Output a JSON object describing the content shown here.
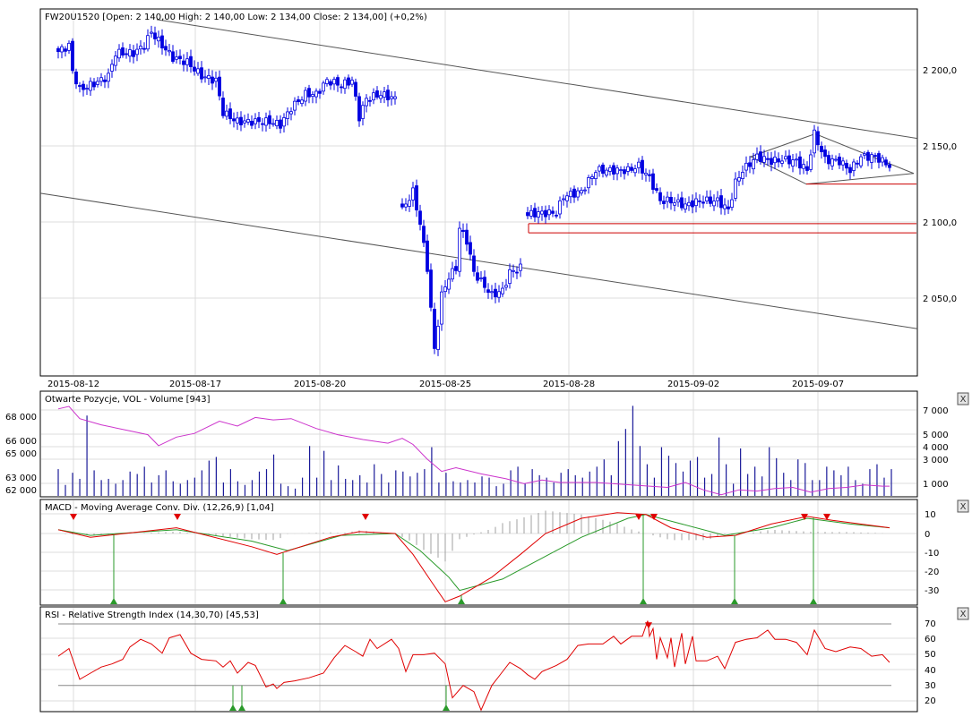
{
  "main": {
    "title": "FW20U1520 [Open: 2 140,00  High: 2 140,00  Low: 2 134,00  Close: 2 134,00] (+0,2%)",
    "price_ticks": [
      "2 200,0",
      "2 150,0",
      "2 100,0",
      "2 050,0"
    ],
    "date_labels": [
      "2015-08-12",
      "2015-08-17",
      "2015-08-20",
      "2015-08-25",
      "2015-08-28",
      "2015-09-02",
      "2015-09-07"
    ]
  },
  "volume_panel": {
    "title": "Otwarte Pozycje, VOL - Volume [943]",
    "left_ticks": [
      "68 000",
      "66 000",
      "65 000",
      "63 000",
      "62 000"
    ],
    "right_ticks": [
      "7 000",
      "5 000",
      "4 000",
      "3 000",
      "1 000"
    ],
    "close_label": "X"
  },
  "macd_panel": {
    "title": "MACD - Moving Average Conv. Div. (12,26,9) [1,04]",
    "ticks": [
      "10",
      "0",
      "-10",
      "-20",
      "-30"
    ],
    "close_label": "X"
  },
  "rsi_panel": {
    "title": "RSI - Relative Strength Index (14,30,70) [45,53]",
    "ticks": [
      "70",
      "60",
      "50",
      "40",
      "30",
      "20"
    ],
    "close_label": "X"
  },
  "colors": {
    "candle": "#0000e0",
    "oi_line": "#cc33cc",
    "volume_bar": "#1a1a99",
    "macd_line": "#e00000",
    "signal_line": "#2a9a2a",
    "histogram": "#a0a0a0",
    "rsi_line": "#e00000",
    "support": "#cc0000"
  },
  "chart_data": [
    {
      "type": "candlestick",
      "title": "FW20U1520",
      "ylim": [
        1999,
        2240
      ],
      "bar_count": 233,
      "price_path_segments": [
        [
          [
            0,
            2212
          ],
          [
            3,
            2216
          ],
          [
            4,
            2199
          ],
          [
            6,
            2187
          ],
          [
            9,
            2190
          ],
          [
            11,
            2192
          ],
          [
            14,
            2196
          ],
          [
            16,
            2211
          ],
          [
            21,
            2211
          ],
          [
            24,
            2216
          ],
          [
            26,
            2225
          ],
          [
            29,
            2216
          ],
          [
            32,
            2208
          ],
          [
            36,
            2205
          ],
          [
            40,
            2196
          ],
          [
            44,
            2193
          ],
          [
            46,
            2172
          ],
          [
            50,
            2166
          ],
          [
            54,
            2166
          ],
          [
            59,
            2166
          ],
          [
            62,
            2164
          ],
          [
            65,
            2175
          ],
          [
            69,
            2184
          ],
          [
            72,
            2184
          ],
          [
            75,
            2193
          ],
          [
            79,
            2190
          ],
          [
            82,
            2193
          ],
          [
            84,
            2169
          ],
          [
            86,
            2181
          ],
          [
            90,
            2184
          ],
          [
            94,
            2181
          ]
        ],
        [
          [
            96,
            2108
          ],
          [
            99,
            2120
          ],
          [
            101,
            2099
          ],
          [
            103,
            2070
          ],
          [
            105,
            2016
          ],
          [
            107,
            2052
          ],
          [
            109,
            2064
          ],
          [
            111,
            2070
          ],
          [
            112,
            2096
          ],
          [
            114,
            2088
          ],
          [
            116,
            2067
          ],
          [
            119,
            2058
          ],
          [
            121,
            2052
          ],
          [
            124,
            2055
          ],
          [
            126,
            2067
          ],
          [
            129,
            2070
          ]
        ],
        [
          [
            131,
            2105
          ],
          [
            134,
            2106
          ],
          [
            139,
            2106
          ],
          [
            141,
            2117
          ],
          [
            146,
            2120
          ],
          [
            150,
            2134
          ],
          [
            154,
            2134
          ],
          [
            159,
            2134
          ],
          [
            162,
            2137
          ],
          [
            165,
            2129
          ],
          [
            168,
            2114
          ],
          [
            171,
            2114
          ],
          [
            175,
            2111
          ],
          [
            179,
            2114
          ],
          [
            184,
            2114
          ],
          [
            187,
            2108
          ],
          [
            189,
            2126
          ],
          [
            191,
            2134
          ],
          [
            195,
            2143
          ],
          [
            199,
            2140
          ],
          [
            202,
            2141
          ],
          [
            206,
            2140
          ],
          [
            209,
            2134
          ],
          [
            211,
            2158
          ],
          [
            214,
            2141
          ],
          [
            218,
            2140
          ],
          [
            221,
            2134
          ],
          [
            224,
            2143
          ],
          [
            228,
            2143
          ],
          [
            230,
            2140
          ],
          [
            232,
            2137
          ]
        ]
      ],
      "trendlines": [
        {
          "name": "upper-channel",
          "from": [
            27.5,
            2233
          ],
          "to": [
            239.75,
            2155
          ]
        },
        {
          "name": "lower-channel",
          "from": [
            -5,
            2119
          ],
          "to": [
            239.75,
            2030
          ]
        }
      ],
      "triangle": [
        [
          193.25,
          2143
        ],
        [
          211.25,
          2158
        ],
        [
          238.75,
          2132
        ],
        [
          208.75,
          2125
        ]
      ],
      "support_levels": [
        {
          "price": 2125,
          "from_bar": 208.75
        },
        {
          "price": 2099,
          "from_bar": 131.25
        },
        {
          "price": 2093,
          "from_bar": 131.25
        }
      ]
    },
    {
      "type": "bar+line",
      "title": "Otwarte Pozycje, VOL - Volume [943]",
      "volume_ylim": [
        0,
        7500
      ],
      "oi_ylim": [
        61000,
        69000
      ],
      "volume": [
        2200,
        900,
        1900,
        1400,
        6600,
        2100,
        1300,
        1400,
        1000,
        1300,
        2000,
        1800,
        2400,
        1100,
        1700,
        2100,
        1200,
        1000,
        1300,
        1500,
        2100,
        2900,
        3200,
        1100,
        2200,
        1200,
        900,
        1300,
        2000,
        2200,
        3400,
        1000,
        800,
        600,
        1500,
        4100,
        1500,
        3700,
        1300,
        2500,
        1400,
        1300,
        1700,
        1100,
        2600,
        1800,
        1100,
        2100,
        2000,
        1600,
        1900,
        2200,
        4000,
        1100,
        1900,
        1200,
        1100,
        1300,
        1100,
        1600,
        1500,
        800,
        1000,
        2100,
        2400,
        1000,
        2200,
        1700,
        1500,
        1100,
        1900,
        2200,
        1700,
        1500,
        2000,
        2400,
        3000,
        1700,
        4500,
        5500,
        7400,
        4100,
        2600,
        1500,
        4000,
        3300,
        2700,
        2000,
        2900,
        3200,
        1500,
        1800,
        4800,
        2600,
        1000,
        3900,
        1800,
        2400,
        1600,
        4000,
        3100,
        1900,
        1300,
        3000,
        2700,
        1300,
        1300,
        2400,
        2100,
        1700,
        2400,
        1300,
        1000,
        2200,
        2600,
        1500,
        2200
      ],
      "open_interest_k": [
        [
          0,
          68.6
        ],
        [
          3,
          68.8
        ],
        [
          6,
          67.8
        ],
        [
          12,
          67.3
        ],
        [
          20,
          66.8
        ],
        [
          25,
          66.5
        ],
        [
          28,
          65.6
        ],
        [
          33,
          66.3
        ],
        [
          38,
          66.6
        ],
        [
          45,
          67.6
        ],
        [
          50,
          67.2
        ],
        [
          55,
          67.9
        ],
        [
          60,
          67.7
        ],
        [
          65,
          67.8
        ],
        [
          72,
          67.0
        ],
        [
          78,
          66.5
        ],
        [
          85,
          66.1
        ],
        [
          92,
          65.8
        ],
        [
          96,
          66.2
        ],
        [
          99,
          65.7
        ],
        [
          103,
          64.5
        ],
        [
          107,
          63.5
        ],
        [
          111,
          63.8
        ],
        [
          118,
          63.3
        ],
        [
          125,
          62.9
        ],
        [
          130,
          62.5
        ],
        [
          135,
          62.8
        ],
        [
          140,
          62.6
        ],
        [
          150,
          62.6
        ],
        [
          160,
          62.4
        ],
        [
          170,
          62.2
        ],
        [
          175,
          62.6
        ],
        [
          180,
          62.0
        ],
        [
          185,
          61.6
        ],
        [
          190,
          62.0
        ],
        [
          195,
          61.9
        ],
        [
          200,
          62.1
        ],
        [
          205,
          62.2
        ],
        [
          210,
          61.8
        ],
        [
          215,
          62.1
        ],
        [
          220,
          62.2
        ],
        [
          225,
          62.4
        ],
        [
          230,
          62.3
        ],
        [
          232,
          62.3
        ]
      ]
    },
    {
      "type": "line",
      "title": "MACD (12,26,9)",
      "ylim": [
        -38,
        12
      ],
      "macd": [
        [
          0,
          2
        ],
        [
          9,
          -2
        ],
        [
          33,
          3
        ],
        [
          54,
          -7
        ],
        [
          61,
          -11
        ],
        [
          76,
          -2
        ],
        [
          84,
          1
        ],
        [
          94,
          0
        ],
        [
          99,
          -11
        ],
        [
          104,
          -25
        ],
        [
          108,
          -36
        ],
        [
          112,
          -33
        ],
        [
          121,
          -23
        ],
        [
          129,
          -11
        ],
        [
          136,
          0
        ],
        [
          146,
          8
        ],
        [
          156,
          11
        ],
        [
          164,
          10
        ],
        [
          171,
          3
        ],
        [
          181,
          -2
        ],
        [
          189,
          -1
        ],
        [
          199,
          5
        ],
        [
          209,
          9
        ],
        [
          216,
          7
        ],
        [
          232,
          3
        ]
      ],
      "signal": [
        [
          0,
          2
        ],
        [
          9,
          -1
        ],
        [
          33,
          2
        ],
        [
          54,
          -4
        ],
        [
          64,
          -9
        ],
        [
          79,
          -1
        ],
        [
          94,
          0
        ],
        [
          101,
          -9
        ],
        [
          109,
          -23
        ],
        [
          112,
          -30
        ],
        [
          124,
          -24
        ],
        [
          134,
          -14
        ],
        [
          146,
          -2
        ],
        [
          159,
          8
        ],
        [
          164,
          10
        ],
        [
          174,
          5
        ],
        [
          186,
          -1
        ],
        [
          199,
          3
        ],
        [
          209,
          8
        ],
        [
          221,
          5
        ],
        [
          232,
          3
        ]
      ],
      "sell_signals": [
        4.25,
        33.25,
        85.75,
        162,
        166.25,
        208.25,
        214.5
      ],
      "buy_signals": [
        15.5,
        62.75,
        112.5,
        163.25,
        188.75,
        210.75
      ]
    },
    {
      "type": "line",
      "title": "RSI (14,30,70)",
      "ylim": [
        13,
        78
      ],
      "levels": [
        30,
        70
      ],
      "rsi": [
        [
          0,
          49
        ],
        [
          3,
          54
        ],
        [
          6,
          34
        ],
        [
          9,
          38
        ],
        [
          12,
          42
        ],
        [
          15,
          44
        ],
        [
          18,
          47
        ],
        [
          20,
          55
        ],
        [
          23,
          60
        ],
        [
          26,
          57
        ],
        [
          29,
          51
        ],
        [
          31,
          61
        ],
        [
          34,
          63
        ],
        [
          37,
          51
        ],
        [
          40,
          47
        ],
        [
          44,
          46
        ],
        [
          46,
          42
        ],
        [
          48,
          46
        ],
        [
          50,
          38
        ],
        [
          53,
          45
        ],
        [
          55,
          43
        ],
        [
          58,
          29
        ],
        [
          60,
          31
        ],
        [
          61,
          28
        ],
        [
          63,
          32
        ],
        [
          66,
          33
        ],
        [
          70,
          35
        ],
        [
          74,
          38
        ],
        [
          77,
          48
        ],
        [
          80,
          56
        ],
        [
          83,
          52
        ],
        [
          85,
          49
        ],
        [
          87,
          60
        ],
        [
          89,
          54
        ],
        [
          93,
          60
        ],
        [
          95,
          54
        ],
        [
          97,
          39
        ],
        [
          99,
          50
        ],
        [
          102,
          50
        ],
        [
          105,
          51
        ],
        [
          108,
          44
        ],
        [
          110,
          22
        ],
        [
          113,
          30
        ],
        [
          116,
          26
        ],
        [
          118,
          14
        ],
        [
          121,
          30
        ],
        [
          123,
          36
        ],
        [
          126,
          45
        ],
        [
          129,
          41
        ],
        [
          131,
          37
        ],
        [
          133,
          34
        ],
        [
          135,
          39
        ],
        [
          139,
          43
        ],
        [
          142,
          47
        ],
        [
          145,
          56
        ],
        [
          148,
          57
        ],
        [
          152,
          57
        ],
        [
          155,
          62
        ],
        [
          157,
          57
        ],
        [
          160,
          62
        ],
        [
          163,
          62
        ],
        [
          166,
          67
        ],
        [
          168,
          61
        ],
        [
          171,
          61
        ],
        [
          174,
          64
        ],
        [
          177,
          62
        ],
        [
          164.5,
          72
        ],
        [
          165,
          62
        ],
        [
          167,
          47
        ],
        [
          170,
          48
        ],
        [
          172,
          42
        ],
        [
          175,
          44
        ],
        [
          178,
          46
        ],
        [
          181,
          46
        ],
        [
          184,
          49
        ],
        [
          186,
          41
        ],
        [
          189,
          58
        ],
        [
          192,
          60
        ],
        [
          195,
          61
        ],
        [
          198,
          66
        ],
        [
          200,
          60
        ],
        [
          203,
          60
        ],
        [
          206,
          58
        ],
        [
          209,
          50
        ],
        [
          211,
          66
        ],
        [
          214,
          54
        ],
        [
          217,
          52
        ],
        [
          221,
          55
        ],
        [
          224,
          54
        ],
        [
          227,
          49
        ],
        [
          230,
          50
        ],
        [
          232,
          45
        ]
      ],
      "buy_signals": [
        48.75,
        51.25,
        108.25
      ],
      "sell_signals": [
        164.75
      ]
    }
  ]
}
